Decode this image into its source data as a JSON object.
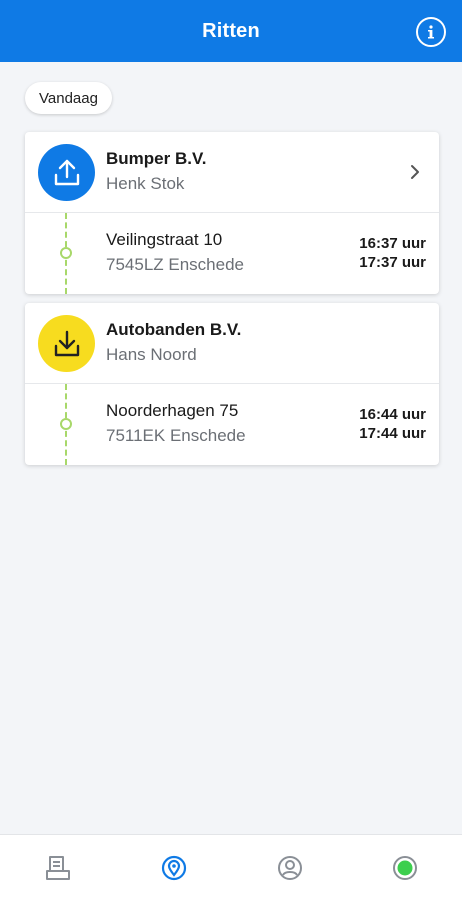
{
  "header": {
    "title": "Ritten",
    "info_icon": "info-icon"
  },
  "date_chip": {
    "label": "Vandaag"
  },
  "colors": {
    "primary": "#0f7ae5",
    "pickup_yellow": "#f7dc1f",
    "route_green": "#a8d86a",
    "active_status": "#3ccf4e"
  },
  "trips": [
    {
      "type": "upload-icon",
      "company": "Bumper B.V.",
      "contact": "Henk Stok",
      "street": "Veilingstraat 10",
      "city": "7545LZ Enschede",
      "time_start": "16:37 uur",
      "time_end": "17:37 uur"
    },
    {
      "type": "download-icon",
      "company": "Autobanden B.V.",
      "contact": "Hans Noord",
      "street": "Noorderhagen 75",
      "city": "7511EK Enschede",
      "time_start": "16:44 uur",
      "time_end": "17:44 uur"
    }
  ],
  "bottom_nav": {
    "items": [
      {
        "icon": "documents-icon"
      },
      {
        "icon": "location-pin-icon",
        "active": true
      },
      {
        "icon": "profile-icon"
      },
      {
        "icon": "online-status-icon"
      }
    ]
  }
}
